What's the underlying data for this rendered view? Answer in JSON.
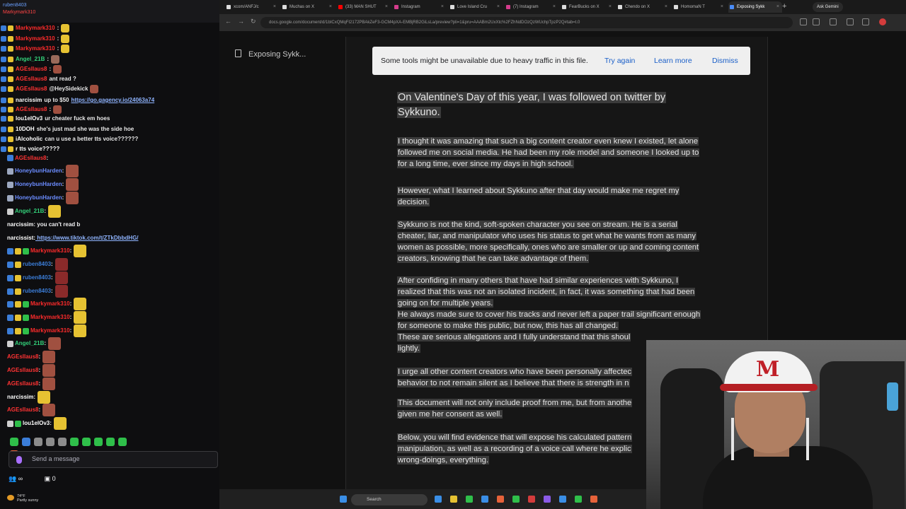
{
  "chat": {
    "top_lines": [
      "ruben8403",
      "Markymark310"
    ],
    "lines": [
      {
        "name": "Markymark310",
        "color": "#ff2b2b",
        "msg": ":",
        "emote": "#e6c232"
      },
      {
        "name": "Markymark310",
        "color": "#ff2b2b",
        "msg": ":",
        "emote": "#e6c232"
      },
      {
        "name": "Markymark310",
        "color": "#ff2b2b",
        "msg": ":",
        "emote": "#e6c232"
      },
      {
        "name": "Angel_21B",
        "color": "#33d17a",
        "msg": ":",
        "emote": "#9a6a5a"
      },
      {
        "name": "AGEsllaus8",
        "color": "#ff3333",
        "msg": ":",
        "emote": "#a05040"
      },
      {
        "name": "AGEsllaus8",
        "color": "#ff3333",
        "msg": "ant read ?",
        "emote": ""
      },
      {
        "name": "AGEsllaus8",
        "color": "#ff3333",
        "msg": "@HeySidekick",
        "emote": "#a05040"
      },
      {
        "name": "narcissim",
        "color": "#ffffff",
        "msg": "up to $50",
        "link": "https://go.gagency.io/24063a74"
      },
      {
        "name": "AGEsllaus8",
        "color": "#ff3333",
        "msg": ":",
        "emote": "#a05040"
      },
      {
        "name": "lou1elOv3",
        "color": "#ffffff",
        "msg": "ur cheater fuck em hoes",
        "emote": ""
      },
      {
        "name": "10DOH",
        "color": "#ffffff",
        "msg": "she's just mad she was the side hoe",
        "emote": ""
      },
      {
        "name": "iAlcoholic",
        "color": "#ffffff",
        "msg": "can u use a better tts voice??????",
        "emote": ""
      },
      {
        "name": "r tts voice?????",
        "color": "#ffffff",
        "msg": "",
        "emote": ""
      }
    ],
    "rows": [
      {
        "name": "AGEsllaus8",
        "color": "#ff3333",
        "msg": ":",
        "badges": [
          "#3b7dd8"
        ],
        "emote": ""
      },
      {
        "name": "HoneybunHarden",
        "color": "#6b8cff",
        "msg": ":",
        "badges": [
          "#9da8c0"
        ],
        "emote": "#a05040"
      },
      {
        "name": "HoneybunHarden",
        "color": "#6b8cff",
        "msg": ":",
        "badges": [
          "#9da8c0"
        ],
        "emote": "#a05040"
      },
      {
        "name": "HoneybunHarden",
        "color": "#6b8cff",
        "msg": ":",
        "badges": [
          "#9da8c0"
        ],
        "emote": "#a05040"
      },
      {
        "name": "Angel_21B",
        "color": "#33d17a",
        "msg": ":",
        "badges": [
          "#cfcfcf"
        ],
        "emote": "#e6c232"
      },
      {
        "name": "narcissim",
        "color": "#ffffff",
        "msg": "you can't read b",
        "badges": [],
        "emote": ""
      },
      {
        "name": "narcissist",
        "color": "#ffffff",
        "msg": "",
        "link": "https://www.tiktok.com/t/ZTkDbbdHG/",
        "badges": [],
        "emote": ""
      },
      {
        "name": "Markymark310",
        "color": "#ff2b2b",
        "msg": ":",
        "badges": [
          "#3b7dd8",
          "#e6c232",
          "#2fbf4a"
        ],
        "emote": "#e6c232"
      },
      {
        "name": "ruben8403",
        "color": "#3b7dd8",
        "msg": ":",
        "badges": [
          "#3b7dd8",
          "#e6c232"
        ],
        "emote": "#8a2a2a"
      },
      {
        "name": "ruben8403",
        "color": "#3b7dd8",
        "msg": ":",
        "badges": [
          "#3b7dd8",
          "#e6c232"
        ],
        "emote": "#8a2a2a"
      },
      {
        "name": "ruben8403",
        "color": "#3b7dd8",
        "msg": ":",
        "badges": [
          "#3b7dd8",
          "#e6c232"
        ],
        "emote": "#8a2a2a"
      },
      {
        "name": "Markymark310",
        "color": "#ff2b2b",
        "msg": ":",
        "badges": [
          "#3b7dd8",
          "#e6c232",
          "#2fbf4a"
        ],
        "emote": "#e6c232"
      },
      {
        "name": "Markymark310",
        "color": "#ff2b2b",
        "msg": ":",
        "badges": [
          "#3b7dd8",
          "#e6c232",
          "#2fbf4a"
        ],
        "emote": "#e6c232"
      },
      {
        "name": "Markymark310",
        "color": "#ff2b2b",
        "msg": ":",
        "badges": [
          "#3b7dd8",
          "#e6c232",
          "#2fbf4a"
        ],
        "emote": "#e6c232"
      },
      {
        "name": "Angel_21B",
        "color": "#33d17a",
        "msg": ":",
        "badges": [
          "#cfcfcf"
        ],
        "emote": "#a05040"
      },
      {
        "name": "AGEsllaus8",
        "color": "#ff3333",
        "msg": ":",
        "badges": [],
        "emote": "#a05040"
      },
      {
        "name": "AGEsllaus8",
        "color": "#ff3333",
        "msg": ":",
        "badges": [],
        "emote": "#a05040"
      },
      {
        "name": "AGEsllaus8",
        "color": "#ff3333",
        "msg": ":",
        "badges": [],
        "emote": "#a05040"
      },
      {
        "name": "narcissim",
        "color": "#ffffff",
        "msg": ":",
        "badges": [],
        "emote": "#e6c232"
      },
      {
        "name": "AGEsllaus8",
        "color": "#ff3333",
        "msg": ":",
        "badges": [],
        "emote": "#a05040"
      },
      {
        "name": "lou1elOv3",
        "color": "#ffffff",
        "msg": ":",
        "badges": [
          "#cfcfcf",
          "#2fbf4a"
        ],
        "emote": "#e6c232"
      }
    ],
    "emote_bar_colors": [
      "#2fbf4a",
      "#3b7dd8",
      "#8c8c8c",
      "#8c8c8c",
      "#8c8c8c",
      "#2fbf4a",
      "#2fbf4a",
      "#2fbf4a",
      "#2fbf4a",
      "#2fbf4a",
      "#e6623a"
    ],
    "input_placeholder": "Send a message",
    "footer": {
      "viewers": "∞",
      "points": "0"
    }
  },
  "browser": {
    "tabs": [
      {
        "label": "xcom/ANFJ/c",
        "color": "#dddddd"
      },
      {
        "label": "Muchas on X",
        "color": "#dddddd"
      },
      {
        "label": "(33) MAN SHUT",
        "color": "#ff0000"
      },
      {
        "label": "Instagram",
        "color": "#d43c8c"
      },
      {
        "label": "Love Island Cru",
        "color": "#dddddd"
      },
      {
        "label": "(7) Instagram",
        "color": "#d43c8c"
      },
      {
        "label": "FearBucks on X",
        "color": "#dddddd"
      },
      {
        "label": "Chendo on X",
        "color": "#dddddd"
      },
      {
        "label": "HomomaN T",
        "color": "#dddddd"
      },
      {
        "label": "Exposing Sykk",
        "color": "#4a8cf7",
        "active": true
      }
    ],
    "new_tab": "+",
    "gemini": "Ask Gemini",
    "url": "docs.google.com/document/d/1bICxQMqFI2172PBAkZeF3-GCM4pXA-EMBjRB2GiLsLa/preview?pli=1&pru=AAABm2UxXtc%2FZhNdDOzQzWUchpTpzP2Q#tab=t.0"
  },
  "doc": {
    "side_title": "Exposing Sykk...",
    "banner": {
      "text": "Some tools might be unavailable due to heavy traffic in this file.",
      "try_again": "Try again",
      "learn_more": "Learn more",
      "dismiss": "Dismiss"
    },
    "heading": [
      "On Valentine's Day of this year, I was followed on twitter by",
      "Sykkuno."
    ],
    "paragraphs": [
      [
        "I thought it was amazing that such a big content creator even knew I existed, let alone",
        "followed me on social media. He had been my role model and someone I looked up to",
        "for a long time, ever since my days in high school."
      ],
      [
        "However, what I learned about Sykkuno after that day would make me regret my",
        "decision."
      ],
      [
        "Sykkuno is not the kind, soft-spoken character you see on stream. He is a serial",
        "cheater, liar, and manipulator who uses his status to get what he wants from as many",
        "women as possible, more specifically, ones who are smaller or up and coming content",
        "creators, knowing that he can take advantage of them."
      ],
      [
        "After confiding in many others that have had similar experiences with Sykkuno, I",
        "realized that this was not an isolated incident, in fact, it was something that had been",
        "going on for multiple years.",
        "He always made sure to cover his tracks and never left a paper trail significant enough",
        "for someone to make this public, but now, this has all changed.",
        "These are serious allegations and I fully understand that this shoul",
        "lightly."
      ],
      [
        "I urge all other content creators who have been personally affectec",
        "behavior to not remain silent as I believe that there is strength in n"
      ],
      [
        "This document will not only include proof from me, but from anothe",
        "given me her consent as well."
      ],
      [
        "Below, you will find evidence that will expose his calculated pattern",
        "manipulation, as well as a recording of a voice call where he explic",
        "wrong-doings, everything."
      ]
    ]
  },
  "taskbar": {
    "search": "Search",
    "weather": [
      "74°F",
      "Partly sunny"
    ],
    "apps": [
      "#3a8ee6",
      "#e6c232",
      "#2fbf4a",
      "#3a8ee6",
      "#e6623a",
      "#2fbf4a",
      "#d43c3c",
      "#8a5ae6",
      "#3a8ee6",
      "#2fbf4a",
      "#e6623a"
    ]
  }
}
